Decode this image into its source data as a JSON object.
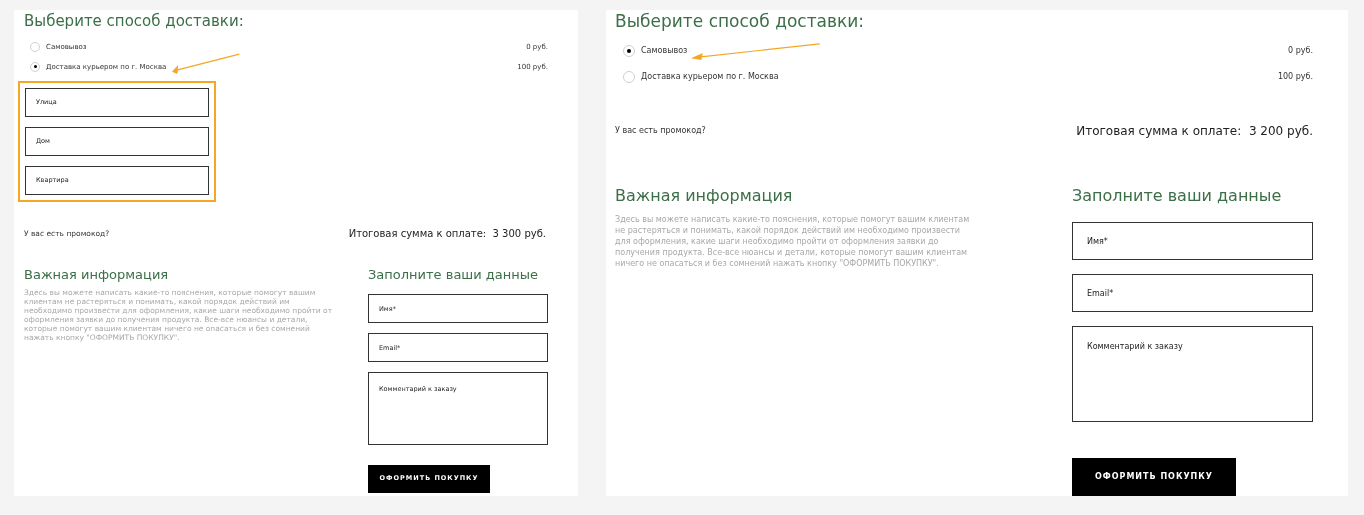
{
  "panels": [
    {
      "delivery_title": "Выберите способ доставки:",
      "options": [
        {
          "label": "Самовывоз",
          "price": "0 руб.",
          "selected": false
        },
        {
          "label": "Доставка курьером по г. Москва",
          "price": "100 руб.",
          "selected": true
        }
      ],
      "address_fields": [
        {
          "placeholder": "Улица"
        },
        {
          "placeholder": "Дом"
        },
        {
          "placeholder": "Квартира"
        }
      ],
      "promo_link": "У вас есть промокод?",
      "total": "Итоговая сумма к оплате:  3 300 руб.",
      "info_title": "Важная информация",
      "info_text": "Здесь вы можете написать какие-то пояснения, которые помогут вашим клиентам не растеряться и понимать, какой порядок действий им необходимо произвести для оформления, какие шаги необходимо пройти от оформления заявки до получения продукта. Все-все нюансы и детали, которые помогут вашим клиентам ничего не опасаться и без сомнений нажать кнопку \"ОФОРМИТЬ ПОКУПКУ\".",
      "form_title": "Заполните ваши данные",
      "fields": [
        {
          "placeholder": "Имя*",
          "kind": "input"
        },
        {
          "placeholder": "Email*",
          "kind": "input"
        },
        {
          "placeholder": "Комментарий к заказу",
          "kind": "textarea"
        }
      ],
      "submit": "ОФОРМИТЬ ПОКУПКУ"
    },
    {
      "delivery_title": "Выберите способ доставки:",
      "options": [
        {
          "label": "Самовывоз",
          "price": "0 руб.",
          "selected": true
        },
        {
          "label": "Доставка курьером по г. Москва",
          "price": "100 руб.",
          "selected": false
        }
      ],
      "promo_link": "У вас есть промокод?",
      "total": "Итоговая сумма к оплате:  3 200 руб.",
      "info_title": "Важная информация",
      "info_text": "Здесь вы можете написать какие-то пояснения, которые помогут вашим клиентам не растеряться и понимать, какой порядок действий им необходимо произвести для оформления, какие шаги необходимо пройти от оформления заявки до получения продукта. Все-все нюансы и детали, которые помогут вашим клиентам ничего не опасаться и без сомнений нажать кнопку \"ОФОРМИТЬ ПОКУПКУ\".",
      "form_title": "Заполните ваши данные",
      "fields": [
        {
          "placeholder": "Имя*",
          "kind": "input"
        },
        {
          "placeholder": "Email*",
          "kind": "input"
        },
        {
          "placeholder": "Комментарий к заказу",
          "kind": "textarea"
        }
      ],
      "submit": "ОФОРМИТЬ ПОКУПКУ"
    }
  ]
}
